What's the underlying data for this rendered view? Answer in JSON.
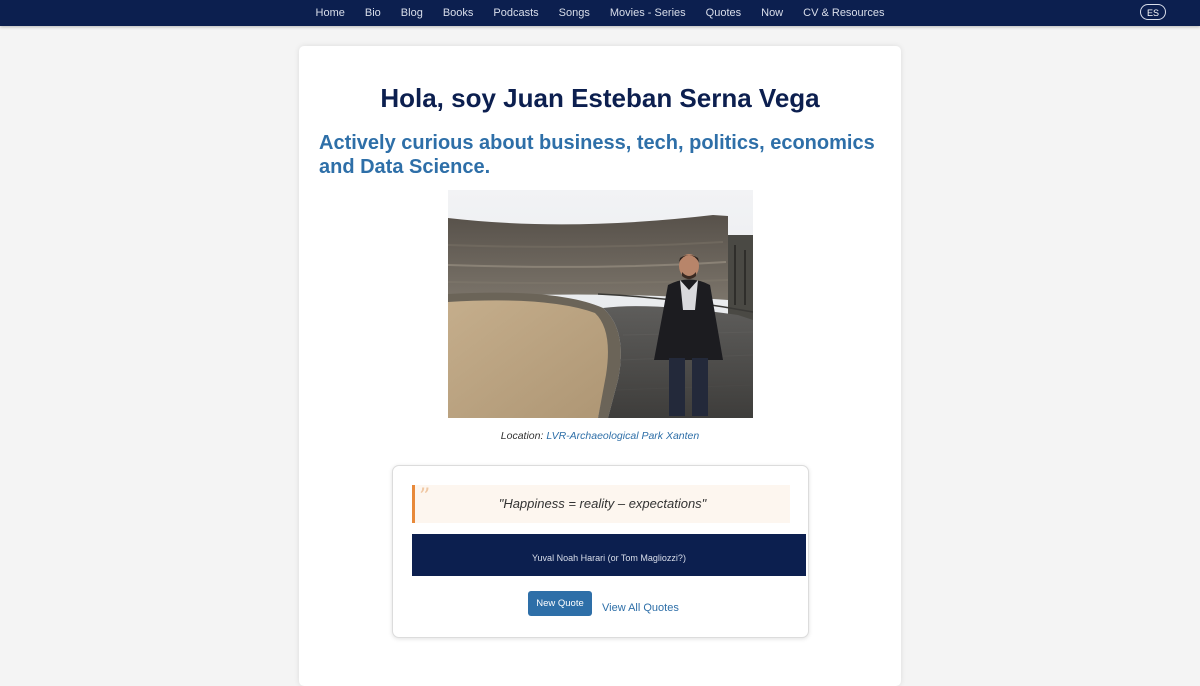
{
  "nav": {
    "items": [
      {
        "label": "Home"
      },
      {
        "label": "Bio"
      },
      {
        "label": "Blog"
      },
      {
        "label": "Books"
      },
      {
        "label": "Podcasts"
      },
      {
        "label": "Songs"
      },
      {
        "label": "Movies - Series"
      },
      {
        "label": "Quotes"
      },
      {
        "label": "Now"
      },
      {
        "label": "CV & Resources"
      }
    ],
    "language_label": "ES"
  },
  "hero": {
    "title": "Hola, soy Juan Esteban Serna Vega",
    "tagline": "Actively curious about business, tech, politics, economics and Data Science."
  },
  "photo": {
    "caption_prefix": "Location:",
    "location_link": "LVR-Archaeological Park Xanten"
  },
  "quote": {
    "mark": "”",
    "text": "\"Happiness = reality – expectations\"",
    "author": "Yuval Noah Harari (or Tom Magliozzi?)",
    "new_quote_label": "New Quote",
    "view_all_label": "View All Quotes"
  },
  "colors": {
    "navbar": "#0c1f4f",
    "title": "#0c1f4f",
    "accent": "#2e6fa8",
    "quote_border": "#e8893a",
    "quote_bg": "#fdf6ef"
  }
}
